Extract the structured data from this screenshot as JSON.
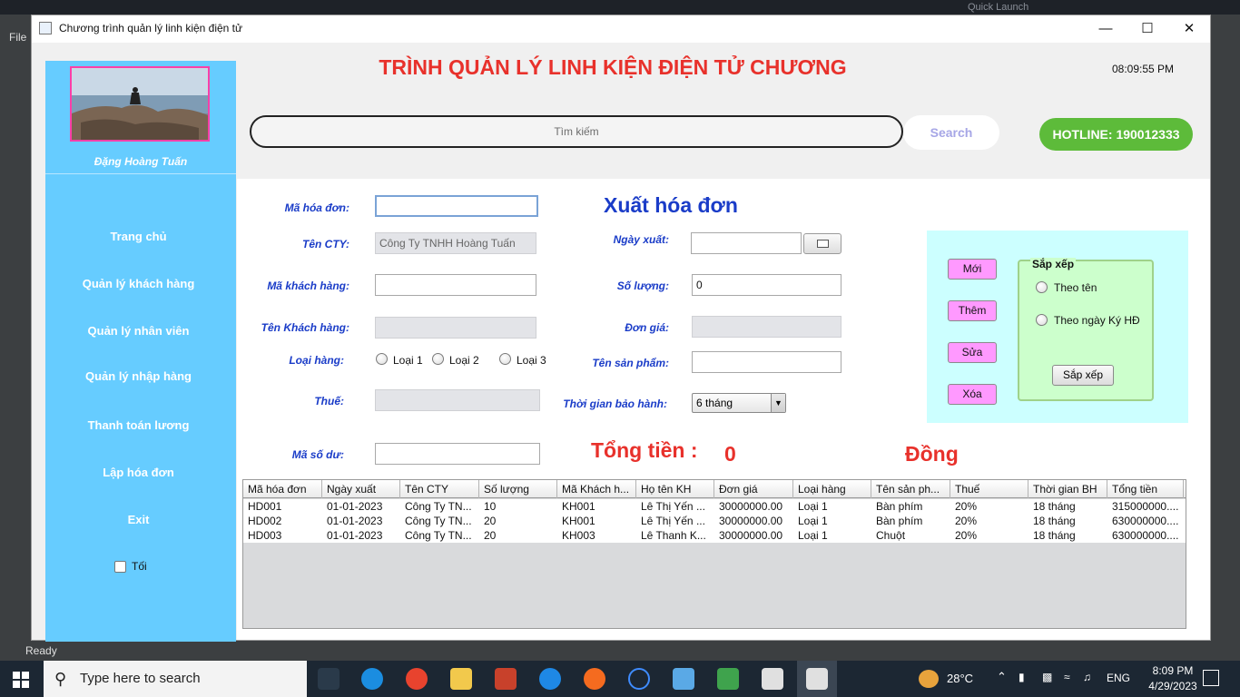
{
  "window": {
    "title": "Chương trình quản lý linh kiện điện tử"
  },
  "ide": {
    "file_menu": "File",
    "status": "Ready",
    "quick_launch": "Quick Launch"
  },
  "sidebar": {
    "user_name": "Đặng Hoàng Tuấn",
    "items": [
      {
        "label": "Trang chủ"
      },
      {
        "label": "Quản lý khách hàng"
      },
      {
        "label": "Quản lý nhân viên"
      },
      {
        "label": "Quản lý nhập hàng"
      },
      {
        "label": "Thanh toán lương"
      },
      {
        "label": "Lập hóa đơn"
      },
      {
        "label": "Exit"
      }
    ],
    "dark_toggle": "Tối"
  },
  "header": {
    "title": "TRÌNH QUẢN LÝ LINH KIỆN ĐIỆN TỬ  CHƯƠNG",
    "clock": "08:09:55 PM",
    "search_placeholder": "Tìm kiếm",
    "search_button": "Search",
    "hotline": "HOTLINE: 190012333"
  },
  "form": {
    "title": "Xuất hóa đơn",
    "invoice_id_label": "Mã hóa đơn:",
    "invoice_id_value": "",
    "company_label": "Tên CTY:",
    "company_value": "Công Ty TNHH Hoàng Tuấn",
    "customer_id_label": "Mã khách hàng:",
    "customer_id_value": "",
    "customer_name_label": "Tên Khách hàng:",
    "customer_name_value": "",
    "category_label": "Loại hàng:",
    "category_options": [
      "Loại 1",
      "Loại 2",
      "Loại 3"
    ],
    "tax_label": "Thuế:",
    "tax_value": "",
    "balance_label": "Mã số dư:",
    "balance_value": "",
    "date_label": "Ngày xuất:",
    "date_value": "",
    "quantity_label": "Số lượng:",
    "quantity_value": "0",
    "price_label": "Đơn giá:",
    "price_value": "",
    "product_label": "Tên sản phẩm:",
    "product_value": "",
    "warranty_label": "Thời gian bảo hành:",
    "warranty_value": "6 tháng",
    "total_label": "Tổng tiền :",
    "total_value": "0",
    "total_unit": "Đồng"
  },
  "actions": {
    "new": "Mới",
    "add": "Thêm",
    "edit": "Sửa",
    "delete": "Xóa",
    "sort_group_title": "Sắp xếp",
    "sort_by_name": "Theo tên",
    "sort_by_date": "Theo ngày Ký HĐ",
    "sort_button": "Sắp xếp"
  },
  "table": {
    "columns": [
      "Mã hóa đơn",
      "Ngày xuất",
      "Tên CTY",
      "Số lượng",
      "Mã Khách h...",
      "Họ tên KH",
      "Đơn giá",
      "Loại hàng",
      "Tên sản ph...",
      "Thuế",
      "Thời gian BH",
      "Tổng tiền"
    ],
    "rows": [
      [
        "HD001",
        "01-01-2023",
        "Công Ty TN...",
        "10",
        "KH001",
        "Lê Thị Yến ...",
        "30000000.00",
        "Loại 1",
        "Bàn phím",
        "20%",
        "18 tháng",
        "315000000...."
      ],
      [
        "HD002",
        "01-01-2023",
        "Công Ty TN...",
        "20",
        "KH001",
        "Lê Thị Yến ...",
        "30000000.00",
        "Loại 1",
        "Bàn phím",
        "20%",
        "18 tháng",
        "630000000...."
      ],
      [
        "HD003",
        "01-01-2023",
        "Công Ty TN...",
        "20",
        "KH003",
        "Lê Thanh K...",
        "30000000.00",
        "Loại 1",
        "Chuột",
        "20%",
        "18 tháng",
        "630000000...."
      ]
    ]
  },
  "taskbar": {
    "search_placeholder": "Type here to search",
    "weather": "28°C",
    "language": "ENG",
    "time": "8:09 PM",
    "date": "4/29/2023"
  }
}
